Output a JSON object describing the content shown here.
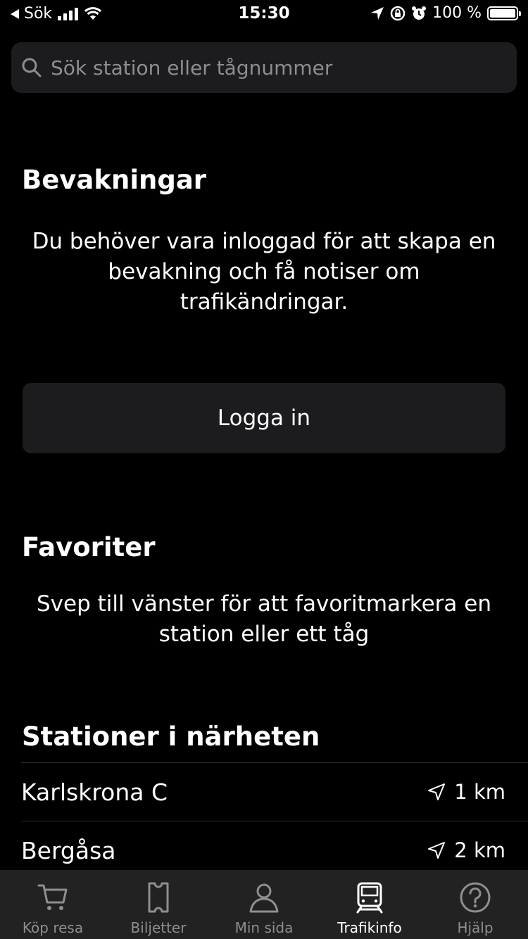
{
  "status_bar": {
    "back_label": "Sök",
    "time": "15:30",
    "battery": "100 %"
  },
  "search": {
    "placeholder": "Sök station eller tågnummer"
  },
  "watches": {
    "title": "Bevakningar",
    "message": "Du behöver vara inloggad för att skapa en bevakning och få notiser om trafikändringar.",
    "login_label": "Logga in"
  },
  "favorites": {
    "title": "Favoriter",
    "message": "Svep till vänster för att favoritmarkera en station eller ett tåg"
  },
  "nearby": {
    "title": "Stationer i närheten",
    "stations": [
      {
        "name": "Karlskrona C",
        "distance": "1 km"
      },
      {
        "name": "Bergåsa",
        "distance": "2 km"
      }
    ]
  },
  "tabs": [
    {
      "label": "Köp resa",
      "icon": "cart-icon",
      "active": false
    },
    {
      "label": "Biljetter",
      "icon": "ticket-icon",
      "active": false
    },
    {
      "label": "Min sida",
      "icon": "person-icon",
      "active": false
    },
    {
      "label": "Trafikinfo",
      "icon": "train-icon",
      "active": true
    },
    {
      "label": "Hjälp",
      "icon": "help-icon",
      "active": false
    }
  ],
  "colors": {
    "background": "#000000",
    "surface": "#1c1c1e",
    "tab_bar": "#222222",
    "inactive": "#8d8d92",
    "text": "#ffffff"
  }
}
